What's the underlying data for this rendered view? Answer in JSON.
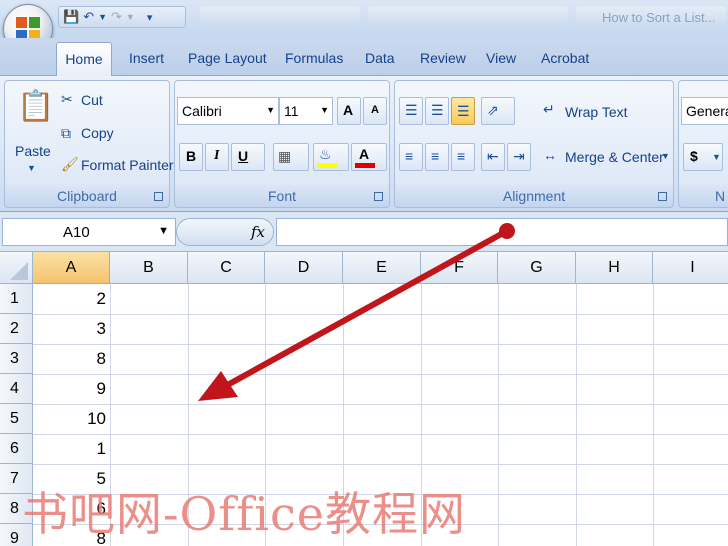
{
  "titlebar": {
    "title_fragment": "How to Sort a List..."
  },
  "tabs": [
    "Home",
    "Insert",
    "Page Layout",
    "Formulas",
    "Data",
    "Review",
    "View",
    "Acrobat"
  ],
  "clipboard": {
    "paste": "Paste",
    "cut": "Cut",
    "copy": "Copy",
    "format_painter": "Format Painter",
    "label": "Clipboard"
  },
  "font": {
    "name": "Calibri",
    "size": "11",
    "bold": "B",
    "italic": "I",
    "underline": "U",
    "grow": "A",
    "shrink": "A",
    "color_letter": "A",
    "label": "Font"
  },
  "alignment": {
    "wrap_text": "Wrap Text",
    "merge_center": "Merge & Center",
    "label": "Alignment"
  },
  "number": {
    "format": "General",
    "currency": "$",
    "label": "N"
  },
  "formula_bar": {
    "name_box": "A10",
    "fx": "fx",
    "value": ""
  },
  "columns": [
    "A",
    "B",
    "C",
    "D",
    "E",
    "F",
    "G",
    "H",
    "I"
  ],
  "rows": [
    "1",
    "2",
    "3",
    "4",
    "5",
    "6",
    "7",
    "8",
    "9"
  ],
  "columnA": [
    "2",
    "3",
    "8",
    "9",
    "10",
    "1",
    "5",
    "6",
    "8"
  ],
  "watermark": "书吧网-Office教程网",
  "colors": {
    "arrow": "#c0161b",
    "watermark": "#e87c74"
  }
}
